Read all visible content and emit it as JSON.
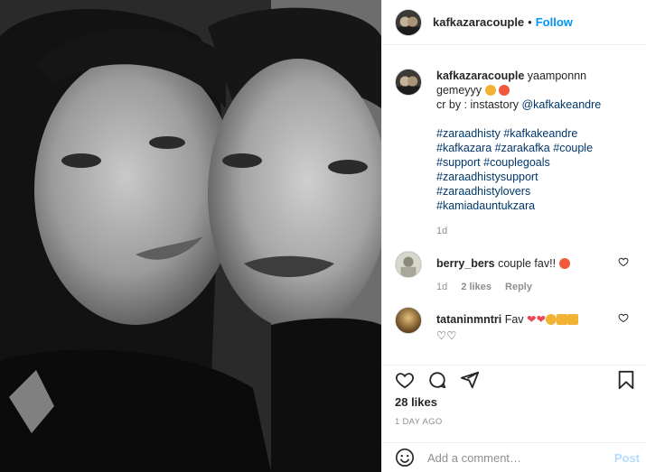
{
  "post": {
    "username": "kafkazaracouple",
    "dot": "•",
    "follow_label": "Follow"
  },
  "caption": {
    "username": "kafkazaracouple",
    "text": "yaamponnn gemeyyy",
    "credit_prefix": "cr by : instastory",
    "credit_mention": "@kafkakeandre",
    "hashtags": [
      "#zaraadhisty #kafkakeandre",
      "#kafkazara #zarakafka #couple",
      "#support #couplegoals",
      "#zaraadhistysupport",
      "#zaraadhistylovers",
      "#kamiadauntukzara"
    ],
    "age": "1d"
  },
  "comments": [
    {
      "username": "berry_bers",
      "text": "couple fav!!",
      "age": "1d",
      "likes": "2 likes",
      "reply": "Reply"
    },
    {
      "username": "tataninmntri",
      "text": "Fav"
    }
  ],
  "likes_count": "28 likes",
  "timestamp": "1 DAY AGO",
  "add_comment": {
    "placeholder": "Add a comment…",
    "post_label": "Post"
  },
  "icons": {
    "heart": "heart-icon",
    "comment": "comment-icon",
    "share": "share-icon",
    "bookmark": "bookmark-icon",
    "emoji": "emoji-icon"
  }
}
